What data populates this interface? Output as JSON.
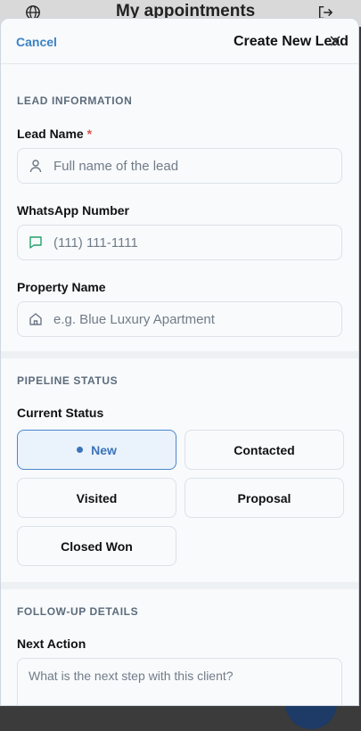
{
  "background": {
    "title": "My appointments",
    "icons": [
      "globe-icon",
      "logout-icon"
    ]
  },
  "sheet": {
    "cancel_label": "Cancel",
    "title": "Create New Lead",
    "close_icon": "close-icon"
  },
  "lead_info": {
    "section_label": "LEAD INFORMATION",
    "lead_name": {
      "label": "Lead Name",
      "required_mark": "*",
      "placeholder": "Full name of the lead",
      "value": ""
    },
    "whatsapp": {
      "label": "WhatsApp Number",
      "placeholder": "(111) 111-1111",
      "value": ""
    },
    "property": {
      "label": "Property Name",
      "placeholder": "e.g. Blue Luxury Apartment",
      "value": ""
    }
  },
  "pipeline": {
    "section_label": "PIPELINE STATUS",
    "current_label": "Current Status",
    "options": [
      "New",
      "Contacted",
      "Visited",
      "Proposal",
      "Closed Won"
    ],
    "selected": "New"
  },
  "followup": {
    "section_label": "FOLLOW-UP DETAILS",
    "next_action_label": "Next Action",
    "next_action_placeholder": "What is the next step with this client?"
  },
  "colors": {
    "accent": "#3b74bb",
    "required": "#e0524a",
    "whatsapp_icon": "#22a06b"
  }
}
